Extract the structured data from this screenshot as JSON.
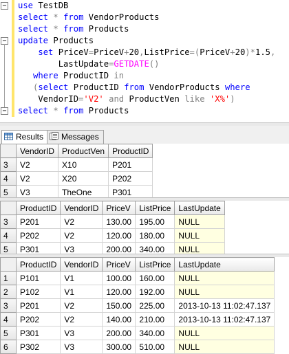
{
  "editor": {
    "lines": [
      [
        {
          "t": "use",
          "c": "kw"
        },
        {
          "t": " TestDB",
          "c": ""
        }
      ],
      [
        {
          "t": "select",
          "c": "kw"
        },
        {
          "t": " ",
          "c": ""
        },
        {
          "t": "*",
          "c": "op"
        },
        {
          "t": " ",
          "c": ""
        },
        {
          "t": "from",
          "c": "kw"
        },
        {
          "t": " VendorProducts",
          "c": ""
        }
      ],
      [
        {
          "t": "select",
          "c": "kw"
        },
        {
          "t": " ",
          "c": ""
        },
        {
          "t": "*",
          "c": "op"
        },
        {
          "t": " ",
          "c": ""
        },
        {
          "t": "from",
          "c": "kw"
        },
        {
          "t": " Products",
          "c": ""
        }
      ],
      [
        {
          "t": "update",
          "c": "kw"
        },
        {
          "t": " Products",
          "c": ""
        }
      ],
      [
        {
          "t": "    ",
          "c": ""
        },
        {
          "t": "set",
          "c": "kw"
        },
        {
          "t": " PriceV",
          "c": ""
        },
        {
          "t": "=",
          "c": "op"
        },
        {
          "t": "PriceV",
          "c": ""
        },
        {
          "t": "+",
          "c": "op"
        },
        {
          "t": "20",
          "c": ""
        },
        {
          "t": ",",
          "c": "op"
        },
        {
          "t": "ListPrice",
          "c": ""
        },
        {
          "t": "=(",
          "c": "op"
        },
        {
          "t": "PriceV",
          "c": ""
        },
        {
          "t": "+",
          "c": "op"
        },
        {
          "t": "20",
          "c": ""
        },
        {
          "t": ")*",
          "c": "op"
        },
        {
          "t": "1.5",
          "c": ""
        },
        {
          "t": ",",
          "c": "op"
        }
      ],
      [
        {
          "t": "        LastUpdate",
          "c": ""
        },
        {
          "t": "=",
          "c": "op"
        },
        {
          "t": "GETDATE",
          "c": "fn"
        },
        {
          "t": "()",
          "c": "op"
        }
      ],
      [
        {
          "t": "   ",
          "c": ""
        },
        {
          "t": "where",
          "c": "kw"
        },
        {
          "t": " ProductID ",
          "c": ""
        },
        {
          "t": "in",
          "c": "op"
        }
      ],
      [
        {
          "t": "   ",
          "c": ""
        },
        {
          "t": "(",
          "c": "op"
        },
        {
          "t": "select",
          "c": "kw"
        },
        {
          "t": " ProductID ",
          "c": ""
        },
        {
          "t": "from",
          "c": "kw"
        },
        {
          "t": " VendorProducts ",
          "c": ""
        },
        {
          "t": "where",
          "c": "kw"
        }
      ],
      [
        {
          "t": "    VendorID",
          "c": ""
        },
        {
          "t": "=",
          "c": "op"
        },
        {
          "t": "'V2'",
          "c": "str"
        },
        {
          "t": " ",
          "c": ""
        },
        {
          "t": "and",
          "c": "op"
        },
        {
          "t": " ProductVen ",
          "c": ""
        },
        {
          "t": "like",
          "c": "op"
        },
        {
          "t": " ",
          "c": ""
        },
        {
          "t": "'X%'",
          "c": "str"
        },
        {
          "t": ")",
          "c": "op"
        }
      ],
      [
        {
          "t": "select",
          "c": "kw"
        },
        {
          "t": " ",
          "c": ""
        },
        {
          "t": "*",
          "c": "op"
        },
        {
          "t": " ",
          "c": ""
        },
        {
          "t": "from",
          "c": "kw"
        },
        {
          "t": " Products",
          "c": ""
        }
      ]
    ]
  },
  "tabs": {
    "results_label": "Results",
    "messages_label": "Messages"
  },
  "grids": [
    {
      "columns": [
        "VendorID",
        "ProductVen",
        "ProductID"
      ],
      "rows": [
        {
          "num": "3",
          "cells": [
            "V2",
            "X10",
            "P201"
          ]
        },
        {
          "num": "4",
          "cells": [
            "V2",
            "X20",
            "P202"
          ]
        },
        {
          "num": "5",
          "cells": [
            "V3",
            "TheOne",
            "P301"
          ]
        }
      ]
    },
    {
      "columns": [
        "ProductID",
        "VendorID",
        "PriceV",
        "ListPrice",
        "LastUpdate"
      ],
      "rows": [
        {
          "num": "3",
          "cells": [
            "P201",
            "V2",
            "130.00",
            "195.00",
            "NULL"
          ]
        },
        {
          "num": "4",
          "cells": [
            "P202",
            "V2",
            "120.00",
            "180.00",
            "NULL"
          ]
        },
        {
          "num": "5",
          "cells": [
            "P301",
            "V3",
            "200.00",
            "340.00",
            "NULL"
          ]
        }
      ]
    },
    {
      "columns": [
        "ProductID",
        "VendorID",
        "PriceV",
        "ListPrice",
        "LastUpdate"
      ],
      "rows": [
        {
          "num": "1",
          "cells": [
            "P101",
            "V1",
            "100.00",
            "160.00",
            "NULL"
          ]
        },
        {
          "num": "2",
          "cells": [
            "P102",
            "V1",
            "120.00",
            "192.00",
            "NULL"
          ]
        },
        {
          "num": "3",
          "cells": [
            "P201",
            "V2",
            "150.00",
            "225.00",
            "2013-10-13 11:02:47.137"
          ]
        },
        {
          "num": "4",
          "cells": [
            "P202",
            "V2",
            "140.00",
            "210.00",
            "2013-10-13 11:02:47.137"
          ]
        },
        {
          "num": "5",
          "cells": [
            "P301",
            "V3",
            "200.00",
            "340.00",
            "NULL"
          ]
        },
        {
          "num": "6",
          "cells": [
            "P302",
            "V3",
            "300.00",
            "510.00",
            "NULL"
          ]
        }
      ]
    }
  ],
  "colors": {
    "keyword": "#0000ff",
    "operator": "#808080",
    "string": "#ff0000",
    "function": "#ff00ff",
    "null_cell": "#ffffe1"
  }
}
